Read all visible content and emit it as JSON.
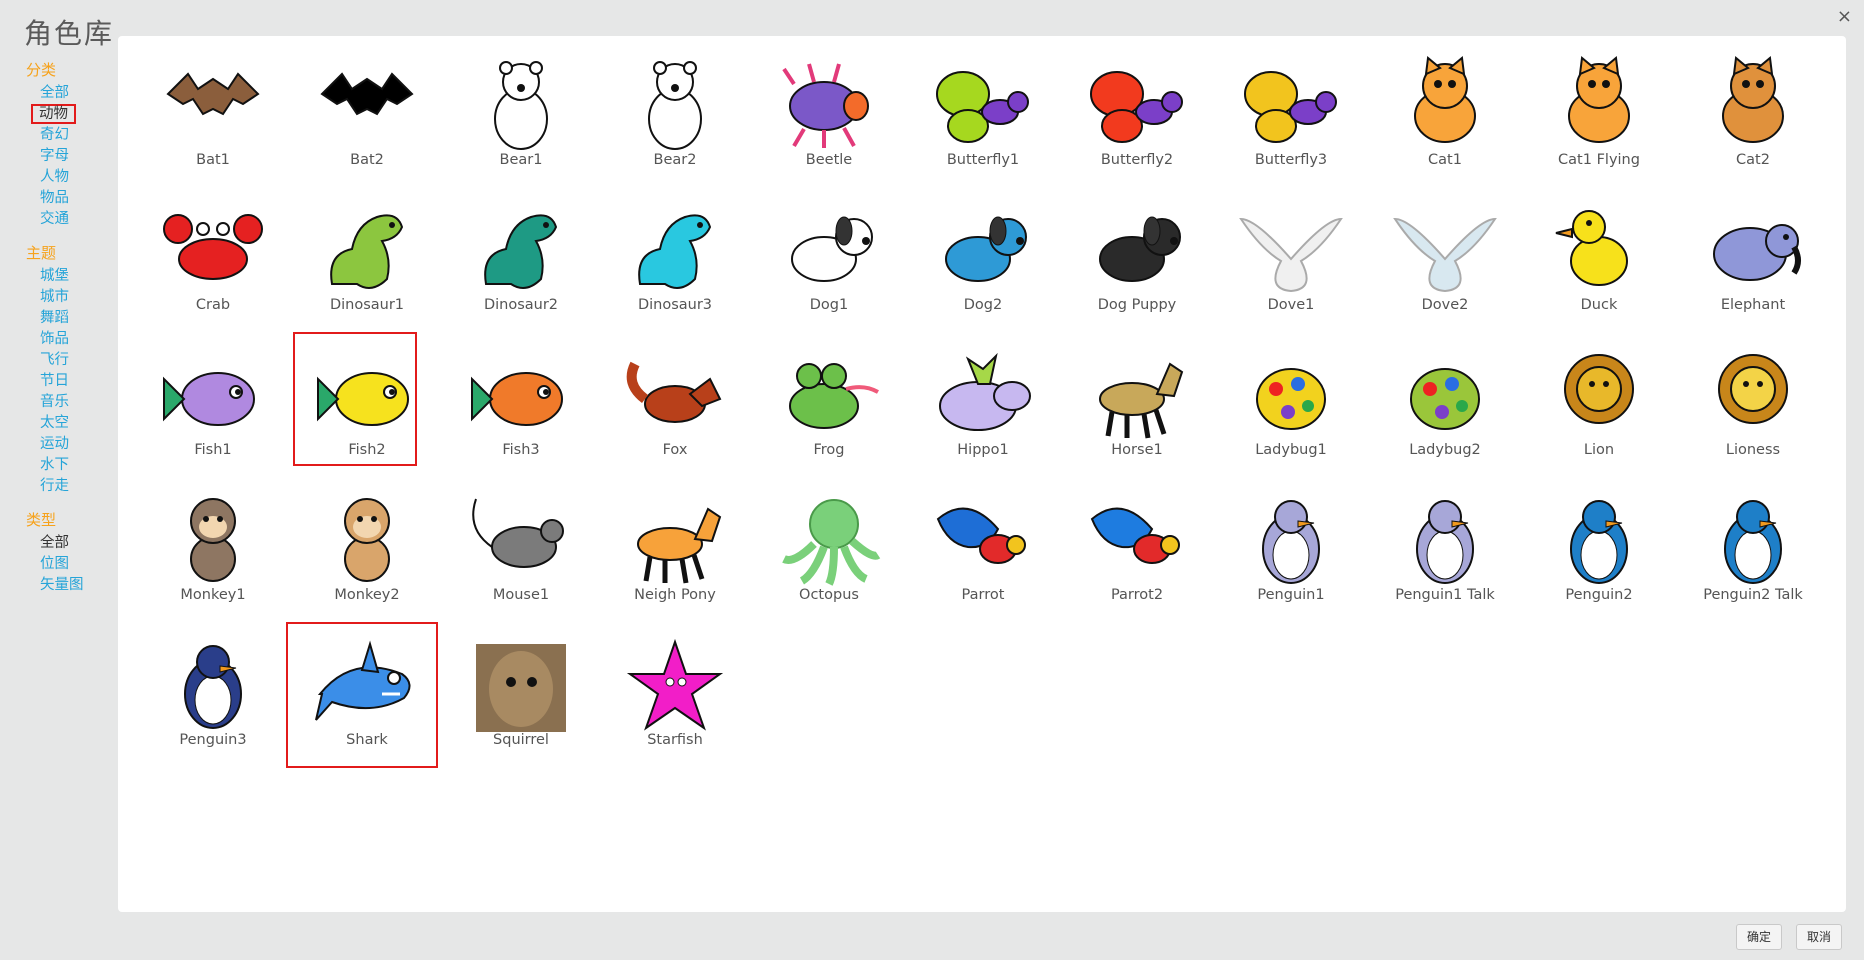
{
  "dialog": {
    "title": "角色库",
    "close_glyph": "×"
  },
  "sidebar": {
    "category": {
      "title": "分类",
      "items": [
        {
          "label": "全部",
          "state": "link"
        },
        {
          "label": "动物",
          "state": "selected"
        },
        {
          "label": "奇幻",
          "state": "link"
        },
        {
          "label": "字母",
          "state": "link"
        },
        {
          "label": "人物",
          "state": "link"
        },
        {
          "label": "物品",
          "state": "link"
        },
        {
          "label": "交通",
          "state": "link"
        }
      ]
    },
    "theme": {
      "title": "主题",
      "items": [
        {
          "label": "城堡",
          "state": "link"
        },
        {
          "label": "城市",
          "state": "link"
        },
        {
          "label": "舞蹈",
          "state": "link"
        },
        {
          "label": "饰品",
          "state": "link"
        },
        {
          "label": "飞行",
          "state": "link"
        },
        {
          "label": "节日",
          "state": "link"
        },
        {
          "label": "音乐",
          "state": "link"
        },
        {
          "label": "太空",
          "state": "link"
        },
        {
          "label": "运动",
          "state": "link"
        },
        {
          "label": "水下",
          "state": "link"
        },
        {
          "label": "行走",
          "state": "link"
        }
      ]
    },
    "type": {
      "title": "类型",
      "items": [
        {
          "label": "全部",
          "state": "dark"
        },
        {
          "label": "位图",
          "state": "link"
        },
        {
          "label": "矢量图",
          "state": "link"
        }
      ]
    }
  },
  "sprites": [
    {
      "name": "Bat1",
      "icon": "bat-icon",
      "color": "#8b5e3c"
    },
    {
      "name": "Bat2",
      "icon": "bat-icon",
      "color": "#000000"
    },
    {
      "name": "Bear1",
      "icon": "bear-icon",
      "color": "#ffffff"
    },
    {
      "name": "Bear2",
      "icon": "bear-icon",
      "color": "#ffffff"
    },
    {
      "name": "Beetle",
      "icon": "beetle-icon",
      "color": "#7b58c8"
    },
    {
      "name": "Butterfly1",
      "icon": "butterfly-icon",
      "color": "#a6d81f"
    },
    {
      "name": "Butterfly2",
      "icon": "butterfly-icon",
      "color": "#f23a1e"
    },
    {
      "name": "Butterfly3",
      "icon": "butterfly-icon",
      "color": "#f2c41e"
    },
    {
      "name": "Cat1",
      "icon": "cat-icon",
      "color": "#f8a43a"
    },
    {
      "name": "Cat1 Flying",
      "icon": "cat-icon",
      "color": "#f8a43a"
    },
    {
      "name": "Cat2",
      "icon": "cat-icon",
      "color": "#e0913c"
    },
    {
      "name": "Crab",
      "icon": "crab-icon",
      "color": "#e52121"
    },
    {
      "name": "Dinosaur1",
      "icon": "dinosaur-icon",
      "color": "#8cc63f"
    },
    {
      "name": "Dinosaur2",
      "icon": "dinosaur-icon",
      "color": "#1e9a84"
    },
    {
      "name": "Dinosaur3",
      "icon": "dinosaur-icon",
      "color": "#29c8e0"
    },
    {
      "name": "Dog1",
      "icon": "dog-icon",
      "color": "#ffffff"
    },
    {
      "name": "Dog2",
      "icon": "dog-icon",
      "color": "#2e9ad6"
    },
    {
      "name": "Dog Puppy",
      "icon": "dog-icon",
      "color": "#2a2a2a"
    },
    {
      "name": "Dove1",
      "icon": "dove-icon",
      "color": "#f0f0f0"
    },
    {
      "name": "Dove2",
      "icon": "dove-icon",
      "color": "#d8e8f0"
    },
    {
      "name": "Duck",
      "icon": "duck-icon",
      "color": "#f7e11b"
    },
    {
      "name": "Elephant",
      "icon": "elephant-icon",
      "color": "#8f97d8"
    },
    {
      "name": "Fish1",
      "icon": "fish-icon",
      "color": "#b089e0"
    },
    {
      "name": "Fish2",
      "icon": "fish-icon",
      "color": "#f6e21e"
    },
    {
      "name": "Fish3",
      "icon": "fish-icon",
      "color": "#f07a2a"
    },
    {
      "name": "Fox",
      "icon": "fox-icon",
      "color": "#b8401a"
    },
    {
      "name": "Frog",
      "icon": "frog-icon",
      "color": "#6cc04a"
    },
    {
      "name": "Hippo1",
      "icon": "hippo-icon",
      "color": "#c7b8f0"
    },
    {
      "name": "Horse1",
      "icon": "horse-icon",
      "color": "#c8a85a"
    },
    {
      "name": "Ladybug1",
      "icon": "ladybug-icon",
      "color": "#f2d21e"
    },
    {
      "name": "Ladybug2",
      "icon": "ladybug-icon",
      "color": "#9ac63a"
    },
    {
      "name": "Lion",
      "icon": "lion-icon",
      "color": "#e8b82a"
    },
    {
      "name": "Lioness",
      "icon": "lion-icon",
      "color": "#f3d347"
    },
    {
      "name": "Monkey1",
      "icon": "monkey-icon",
      "color": "#8e7662"
    },
    {
      "name": "Monkey2",
      "icon": "monkey-icon",
      "color": "#d9a56b"
    },
    {
      "name": "Mouse1",
      "icon": "mouse-icon",
      "color": "#7b7b7b"
    },
    {
      "name": "Neigh Pony",
      "icon": "horse-icon",
      "color": "#f7a23a"
    },
    {
      "name": "Octopus",
      "icon": "octopus-icon",
      "color": "#7ad07a"
    },
    {
      "name": "Parrot",
      "icon": "parrot-icon",
      "color": "#1e6ed6"
    },
    {
      "name": "Parrot2",
      "icon": "parrot-icon",
      "color": "#1e7ce0"
    },
    {
      "name": "Penguin1",
      "icon": "penguin-icon",
      "color": "#a7a7d8"
    },
    {
      "name": "Penguin1 Talk",
      "icon": "penguin-icon",
      "color": "#a7a7d8"
    },
    {
      "name": "Penguin2",
      "icon": "penguin-icon",
      "color": "#1e7fc8"
    },
    {
      "name": "Penguin2 Talk",
      "icon": "penguin-icon",
      "color": "#1e7fc8"
    },
    {
      "name": "Penguin3",
      "icon": "penguin-icon",
      "color": "#2a3e8a"
    },
    {
      "name": "Shark",
      "icon": "shark-icon",
      "color": "#3b8ee8"
    },
    {
      "name": "Squirrel",
      "icon": "squirrel-icon",
      "color": "#8a7050"
    },
    {
      "name": "Starfish",
      "icon": "starfish-icon",
      "color": "#f21ec8"
    }
  ],
  "selected_sprites": [
    "Fish2",
    "Shark"
  ],
  "footer": {
    "ok_label": "确定",
    "cancel_label": "取消"
  }
}
